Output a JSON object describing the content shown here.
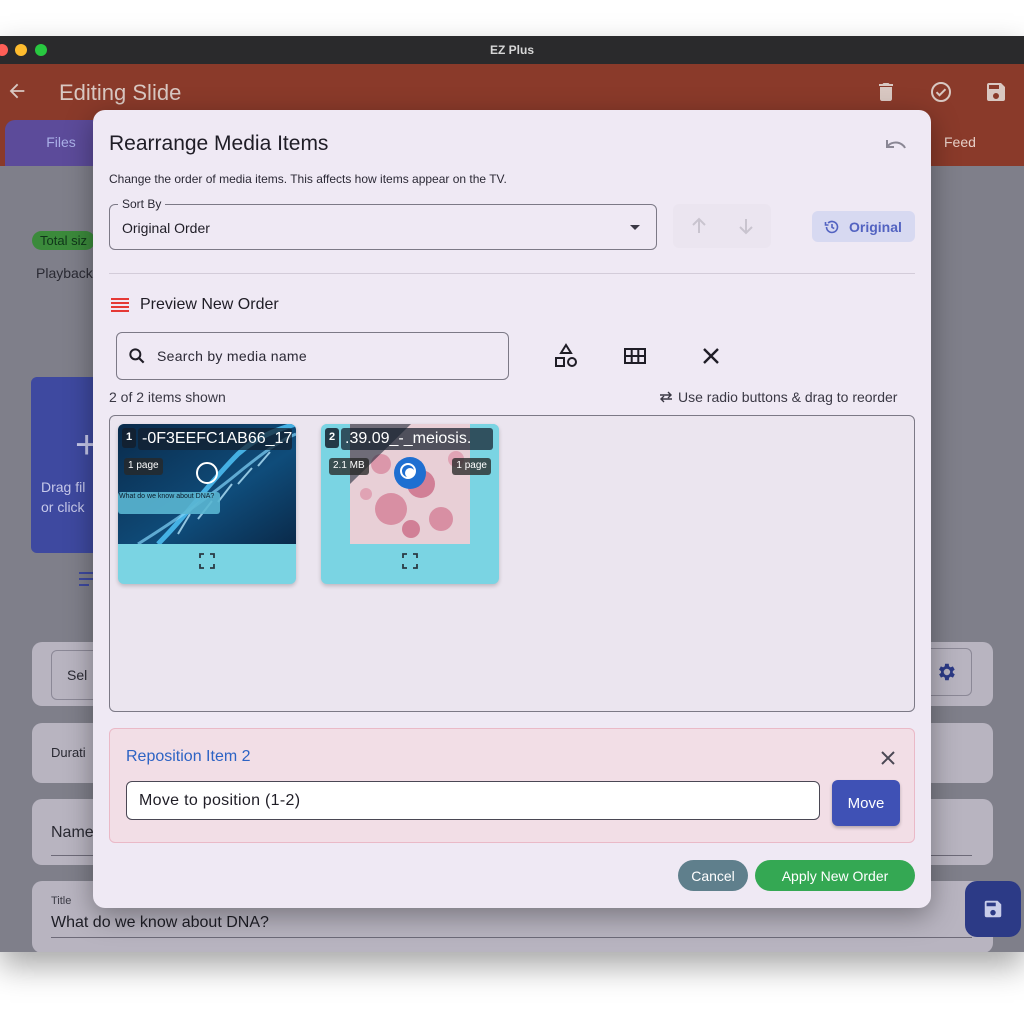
{
  "window": {
    "title": "EZ Plus"
  },
  "app": {
    "title": "Editing Slide",
    "tabs": {
      "files": "Files",
      "feed": "Feed"
    },
    "total_size_badge": "Total siz",
    "playback_label": "Playback",
    "drop_zone": {
      "line1": "Drag fil",
      "line2": "or click"
    },
    "select_label": "Sel",
    "duration_label": "Durati",
    "name_label": "Name",
    "title_field": {
      "label": "Title",
      "value": "What do we know about DNA?"
    },
    "colors": {
      "appbar": "#8a3a2a",
      "primary": "#3f51b5"
    }
  },
  "dialog": {
    "title": "Rearrange Media Items",
    "description": "Change the order of media items. This affects how items appear on the TV.",
    "sort": {
      "legend": "Sort By",
      "value": "Original Order"
    },
    "original_button": "Original",
    "preview_title": "Preview New Order",
    "search": {
      "placeholder": "Search by media name",
      "value": ""
    },
    "count_text": "2 of 2 items shown",
    "hint_text": "Use radio buttons & drag to reorder",
    "items": [
      {
        "position": "1",
        "name": "-0F3EEFC1AB66_17",
        "chips": [
          "1 page"
        ],
        "selected": false,
        "thumb_text": "What do we know about DNA?"
      },
      {
        "position": "2",
        "name": ".39.09_-_meiosis.",
        "chips": [
          "2.1 MB",
          "1 page"
        ],
        "selected": true
      }
    ],
    "reposition": {
      "title": "Reposition Item 2",
      "input_placeholder": "Move to position (1-2)",
      "input_value": "",
      "move_button": "Move"
    },
    "cancel_button": "Cancel",
    "apply_button": "Apply New Order",
    "colors": {
      "accent": "#5363c1",
      "apply": "#34a853",
      "cancel": "#5f7f8c",
      "selected_radio": "#1e6fd1"
    }
  }
}
